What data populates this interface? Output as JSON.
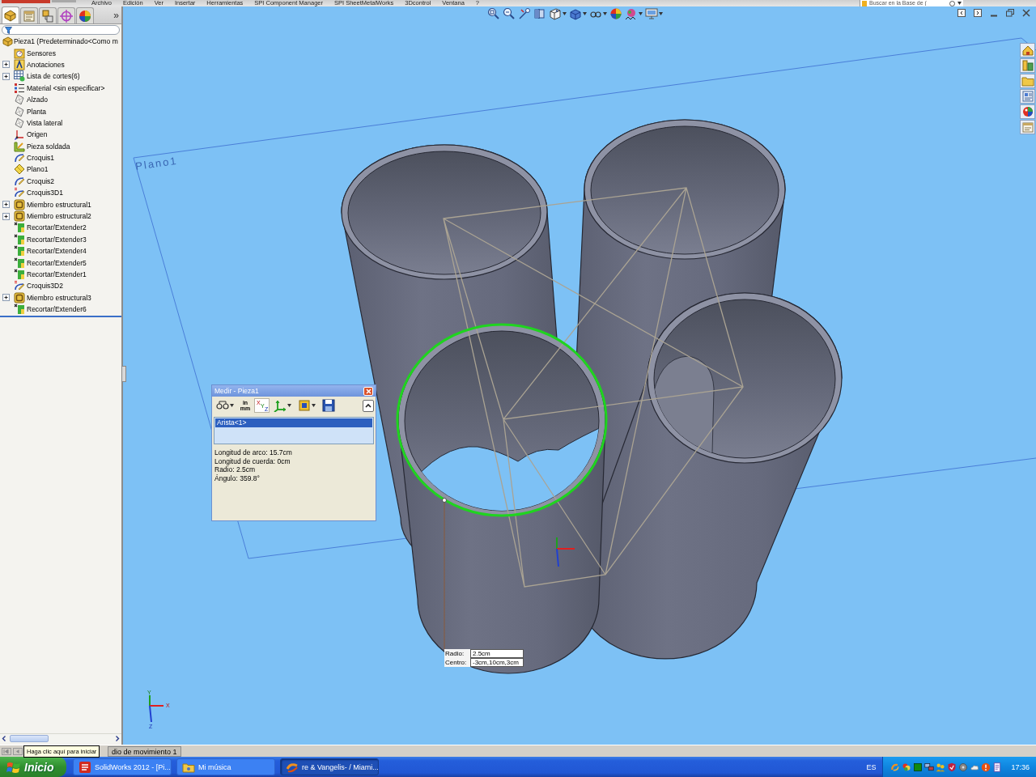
{
  "menu_bar": {
    "items": [
      "Archivo",
      "Edición",
      "Ver",
      "Insertar",
      "Herramientas",
      "SPI Component Manager",
      "SPI SheetMetalWorks",
      "3Dcontrol",
      "Ventana",
      "?"
    ]
  },
  "search": {
    "placeholder": "Buscar en la Base de ("
  },
  "manager_tabs": [
    {
      "kind": "feature",
      "selected": true
    },
    {
      "kind": "property",
      "selected": false
    },
    {
      "kind": "configuration",
      "selected": false
    },
    {
      "kind": "dimxpert",
      "selected": false
    },
    {
      "kind": "display",
      "selected": false
    }
  ],
  "more_tabs": "»",
  "feature_tree": {
    "root": "Pieza1 (Predeterminado<Como m",
    "items": [
      {
        "label": "Sensores",
        "kind": "sensors",
        "collapsed": false
      },
      {
        "label": "Anotaciones",
        "kind": "annotations",
        "collapsed": true
      },
      {
        "label": "Lista de cortes(6)",
        "kind": "cut-list",
        "collapsed": true
      },
      {
        "label": "Material <sin especificar>",
        "kind": "material",
        "collapsed": false
      },
      {
        "label": "Alzado",
        "kind": "plane",
        "collapsed": false
      },
      {
        "label": "Planta",
        "kind": "plane",
        "collapsed": false
      },
      {
        "label": "Vista lateral",
        "kind": "plane",
        "collapsed": false
      },
      {
        "label": "Origen",
        "kind": "origin",
        "collapsed": false
      },
      {
        "label": "Pieza soldada",
        "kind": "weldment",
        "collapsed": false
      },
      {
        "label": "Croquis1",
        "kind": "sketch",
        "collapsed": false
      },
      {
        "label": "Plano1",
        "kind": "plane-feature",
        "collapsed": false
      },
      {
        "label": "Croquis2",
        "kind": "sketch",
        "collapsed": false
      },
      {
        "label": "Croquis3D1",
        "kind": "sketch3d",
        "collapsed": false
      },
      {
        "label": "Miembro estructural1",
        "kind": "structural-member",
        "collapsed": true
      },
      {
        "label": "Miembro estructural2",
        "kind": "structural-member",
        "collapsed": true
      },
      {
        "label": "Recortar/Extender2",
        "kind": "trim-extend",
        "collapsed": false
      },
      {
        "label": "Recortar/Extender3",
        "kind": "trim-extend",
        "collapsed": false
      },
      {
        "label": "Recortar/Extender4",
        "kind": "trim-extend",
        "collapsed": false
      },
      {
        "label": "Recortar/Extender5",
        "kind": "trim-extend",
        "collapsed": false
      },
      {
        "label": "Recortar/Extender1",
        "kind": "trim-extend",
        "collapsed": false
      },
      {
        "label": "Croquis3D2",
        "kind": "sketch3d",
        "collapsed": false
      },
      {
        "label": "Miembro estructural3",
        "kind": "structural-member",
        "collapsed": true
      },
      {
        "label": "Recortar/Extender6",
        "kind": "trim-extend",
        "collapsed": false
      }
    ]
  },
  "viewport": {
    "plane_label": "Plano1",
    "triad_labels": [
      "Y",
      "X",
      "Z"
    ],
    "callout": {
      "rows": [
        {
          "label": "Radio:",
          "value": "2.5cm"
        },
        {
          "label": "Centro:",
          "value": "-3cm,10cm,3cm"
        }
      ]
    }
  },
  "measure_dialog": {
    "title": "Medir - Pieza1",
    "toolbar": [
      {
        "kind": "arc",
        "dropdown": true,
        "pressed": false
      },
      {
        "kind": "units",
        "text": [
          "in",
          "mm"
        ],
        "dropdown": false,
        "pressed": false
      },
      {
        "kind": "xyz",
        "text": [
          "X",
          "Y",
          "Z"
        ],
        "dropdown": false,
        "pressed": true
      },
      {
        "kind": "axes",
        "dropdown": true,
        "pressed": false
      },
      {
        "kind": "projection",
        "dropdown": true,
        "pressed": false
      },
      {
        "kind": "save",
        "dropdown": false,
        "pressed": false
      }
    ],
    "selections": [
      {
        "label": "Arista<1>",
        "selected": true
      }
    ],
    "results": [
      "Longitud de arco: 15.7cm",
      "Longitud de cuerda: 0cm",
      "Radio: 2.5cm",
      "Ángulo: 359.8°"
    ]
  },
  "motion_tabs": {
    "visible_tab": "dio de movimiento 1"
  },
  "tooltip": "Haga clic aquí para iniciar",
  "taskbar": {
    "start": "Inicio",
    "tasks": [
      {
        "kind": "solidworks",
        "label": "SolidWorks 2012 - [Pi...",
        "selected": false
      },
      {
        "kind": "folder",
        "label": "Mi música",
        "selected": false
      },
      {
        "kind": "media",
        "label": "re & Vangelis- / Miami...",
        "selected": true
      }
    ],
    "language": "ES",
    "clock": "17:36"
  }
}
